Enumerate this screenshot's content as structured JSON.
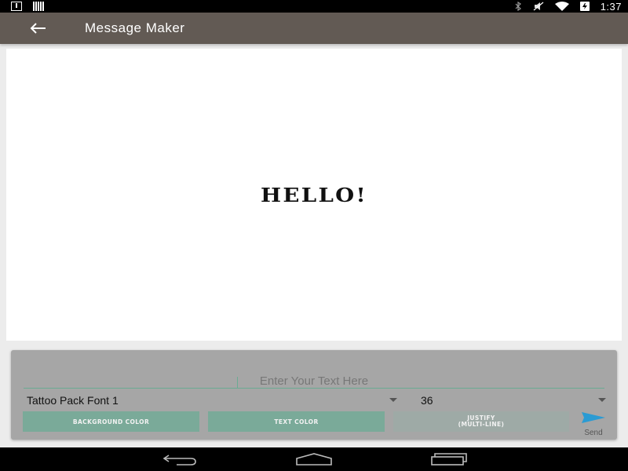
{
  "status_bar": {
    "time": "1:37",
    "icons": [
      "download-icon",
      "signal-bars-icon",
      "bluetooth-icon",
      "mute-icon",
      "wifi-icon",
      "battery-icon"
    ]
  },
  "app_bar": {
    "title": "Message Maker",
    "back_icon": "arrow-left-icon"
  },
  "preview": {
    "text": "HELLO!"
  },
  "editor": {
    "text_input": {
      "value": "",
      "placeholder": "Enter Your Text Here"
    },
    "font": {
      "selected": "Tattoo Pack Font 1"
    },
    "size": {
      "selected": "36"
    },
    "buttons": {
      "background_color": "BACKGROUND COLOR",
      "text_color": "TEXT COLOR",
      "justify_line1": "JUSTIFY",
      "justify_line2": "(MULTI-LINE)"
    },
    "send_label": "Send"
  },
  "colors": {
    "app_bar": "#625a54",
    "accent": "#7aaa99",
    "send_icon": "#2b9bd3",
    "panel": "#a6a6a6"
  },
  "nav_bar": {
    "icons": [
      "nav-back-icon",
      "nav-home-icon",
      "nav-recents-icon"
    ]
  }
}
